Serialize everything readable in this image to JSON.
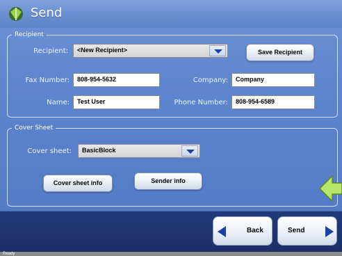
{
  "window": {
    "title": "Send"
  },
  "recipient_group": {
    "legend": "Recipient",
    "recipient_label": "Recipient:",
    "recipient_value": "<New Recipient>",
    "save_button": "Save Recipient",
    "fax_label": "Fax Number:",
    "fax_value": "808-954-5632",
    "company_label": "Company:",
    "company_value": "Company",
    "name_label": "Name:",
    "name_value": "Test User",
    "phone_label": "Phone Number:",
    "phone_value": "808-954-6589"
  },
  "cover_group": {
    "legend": "Cover Sheet",
    "cover_label": "Cover sheet:",
    "cover_value": "BasicBlock",
    "cover_info_button": "Cover sheet info",
    "sender_info_button": "Sender info"
  },
  "nav": {
    "back_label": "Back",
    "send_label": "Send"
  },
  "status": {
    "text": "Ready"
  },
  "colors": {
    "accent": "#1a3fa8",
    "background": "#5f86cf",
    "footer": "#1b2e66"
  },
  "icons": [
    "app-leaf-icon",
    "chevron-down-icon",
    "green-arrow-icon",
    "back-arrow-icon",
    "forward-arrow-icon"
  ]
}
